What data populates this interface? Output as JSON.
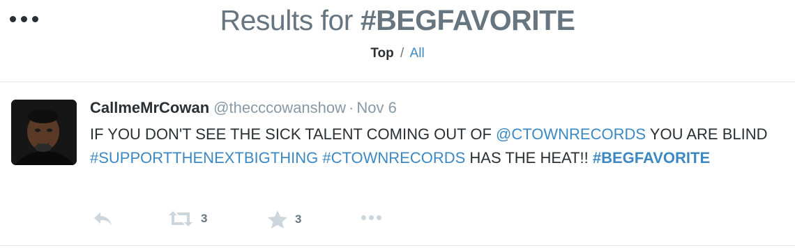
{
  "header": {
    "title_prefix": "Results for ",
    "title_hashtag": "#BEGFAVORITE",
    "tab_top": "Top",
    "tab_separator": "/",
    "tab_all": "All",
    "more_icon": "more-dots-icon"
  },
  "tweet": {
    "name": "CallmeMrCowan",
    "handle": "@thecccowanshow",
    "separator": "·",
    "time": "Nov 6",
    "text_1": "IF YOU DON'T SEE THE SICK TALENT COMING OUT OF ",
    "mention": "@CTOWNRECORDS",
    "text_2": " YOU ARE BLIND ",
    "hashtag_1": "#SUPPORTTHENEXTBIGTHING",
    "text_3": " ",
    "hashtag_2": "#CTOWNRECORDS",
    "text_4": " HAS THE HEAT!! ",
    "hashtag_3": "#BEGFAVORITE",
    "retweet_count": "3",
    "favorite_count": "3"
  },
  "colors": {
    "link": "#3b88c3",
    "muted": "#8899a6",
    "text": "#292f33",
    "icon": "#ccd6dd"
  },
  "icons": [
    "more-dots-icon",
    "reply-icon",
    "retweet-icon",
    "star-icon",
    "more-options-icon"
  ]
}
